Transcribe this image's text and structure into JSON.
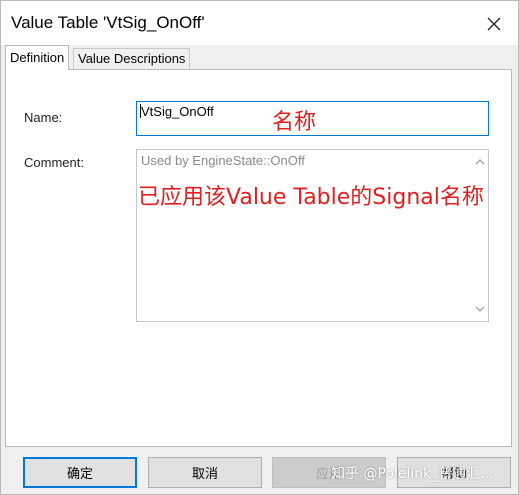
{
  "window": {
    "title": "Value Table 'VtSig_OnOff'",
    "close_icon": "close-icon"
  },
  "tabs": [
    {
      "label": "Definition",
      "active": true
    },
    {
      "label": "Value Descriptions",
      "active": false
    }
  ],
  "form": {
    "name_label": "Name:",
    "name_value": "VtSig_OnOff",
    "comment_label": "Comment:",
    "comment_value": "Used by EngineState::OnOff"
  },
  "annotations": {
    "name_note": "名称",
    "comment_note": "已应用该Value Table的Signal名称",
    "color": "#e02020"
  },
  "buttons": {
    "ok": "确定",
    "cancel": "取消",
    "apply": "应用",
    "help": "帮助"
  },
  "watermark": "知乎 @Polelink_普通汇..."
}
